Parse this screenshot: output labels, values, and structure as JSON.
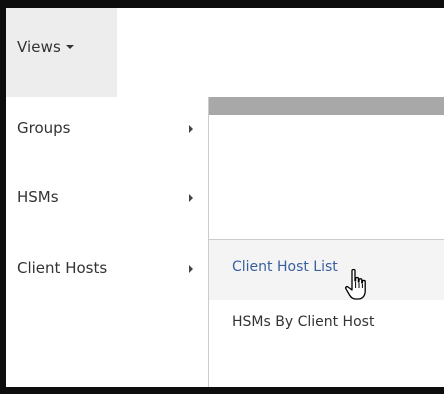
{
  "views_button": {
    "label": "Views"
  },
  "menu": {
    "items": [
      {
        "label": "Groups",
        "has_submenu": true
      },
      {
        "label": "HSMs",
        "has_submenu": true
      },
      {
        "label": "Client Hosts",
        "has_submenu": true
      }
    ]
  },
  "submenu": {
    "items": [
      {
        "label": "Client Host List",
        "state": "hovered"
      },
      {
        "label": "HSMs By Client Host"
      }
    ]
  },
  "colors": {
    "accent_link": "#3a5f9f",
    "views_bg": "#ededed",
    "bar_grey": "#a8a8a8",
    "frame": "#0d0d0d"
  },
  "icons": {
    "caret": "caret-down-icon",
    "submenu_arrow": "caret-right-icon",
    "pointer": "hand-pointer-cursor-icon"
  }
}
